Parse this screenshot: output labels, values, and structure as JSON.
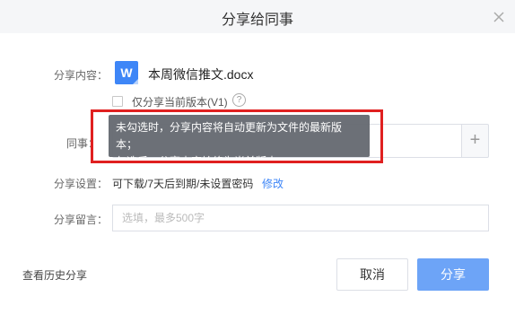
{
  "dialog": {
    "title": "分享给同事",
    "close_icon": "close-icon"
  },
  "content": {
    "label": "分享内容：",
    "file_icon_letter": "W",
    "file_name": "本周微信推文.docx",
    "version_checkbox_label": "仅分享当前版本(V1)",
    "help_icon_glyph": "?"
  },
  "colleague": {
    "label": "同事：",
    "add_glyph": "+"
  },
  "tooltip": {
    "line1": "未勾选时，分享内容将自动更新为文件的最新版本；",
    "line2": "勾选后，分享内容始终为当前版本。"
  },
  "settings": {
    "label": "分享设置：",
    "value": "可下载/7天后到期/未设置密码",
    "edit_link": "修改"
  },
  "message": {
    "label": "分享留言：",
    "placeholder": "选填，最多500字"
  },
  "footer": {
    "history_link": "查看历史分享",
    "cancel_label": "取消",
    "share_label": "分享"
  },
  "colors": {
    "accent": "#3e86f7",
    "share_button": "#6da4f7",
    "highlight": "#e02020"
  }
}
